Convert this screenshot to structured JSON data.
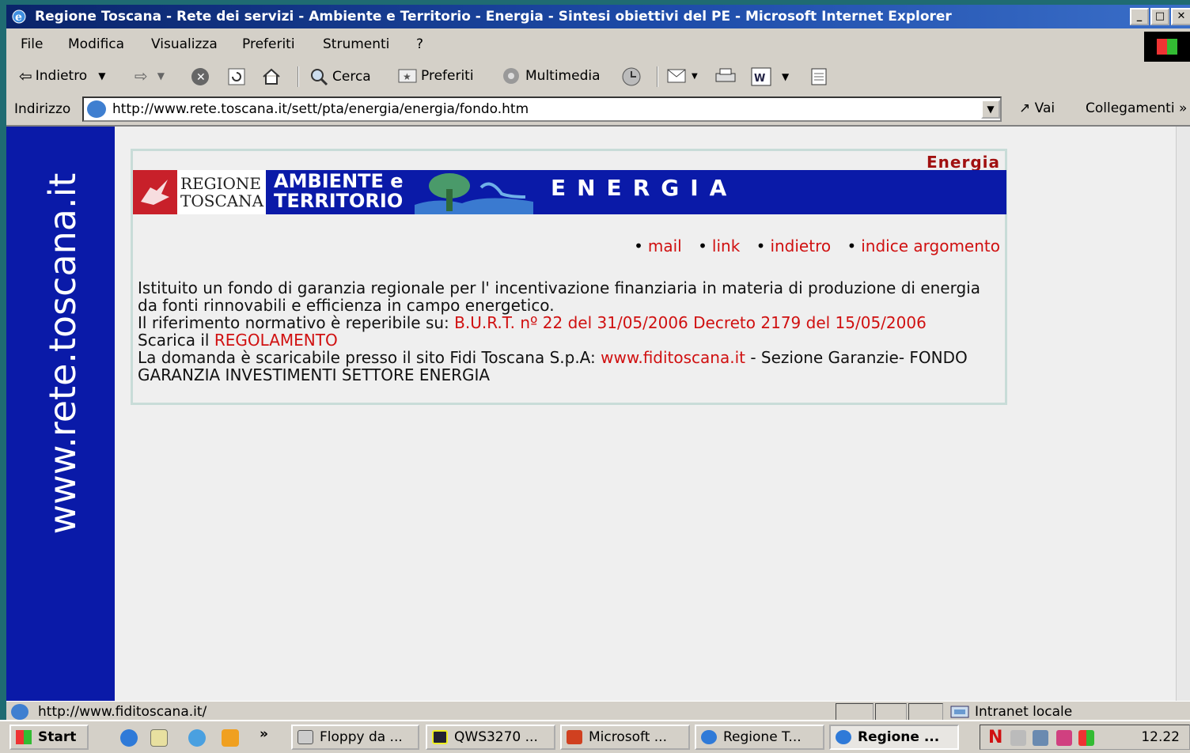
{
  "window": {
    "title": "Regione Toscana - Rete dei servizi - Ambiente e Territorio - Energia - Sintesi obiettivi del PE - Microsoft Internet Explorer",
    "min": "_",
    "max": "□"
  },
  "menu": [
    "File",
    "Modifica",
    "Visualizza",
    "Preferiti",
    "Strumenti",
    "?"
  ],
  "toolbar": {
    "back": "Indietro",
    "search": "Cerca",
    "favorites": "Preferiti",
    "media": "Multimedia"
  },
  "address": {
    "label": "Indirizzo",
    "url": "http://www.rete.toscana.it/sett/pta/energia/energia/fondo.htm",
    "go": "Vai",
    "links": "Collegamenti"
  },
  "page": {
    "sidebar_text": "www.rete.toscana.it",
    "section_title": "Energia",
    "banner": {
      "logo_line1": "REGIONE",
      "logo_line2": "TOSCANA",
      "ambiente_line1": "AMBIENTE e",
      "ambiente_line2": "TERRITORIO",
      "section": "ENERGIA"
    },
    "nav": [
      "mail",
      "link",
      "indietro",
      "indice argomento"
    ],
    "body": {
      "p1": "Istituito un fondo di garanzia regionale per l' incentivazione finanziaria in materia di produzione di energia da fonti rinnovabili e efficienza in campo energetico.",
      "p2_prefix": "Il riferimento normativo è reperibile su: ",
      "p2_link": "B.U.R.T. nº 22 del 31/05/2006 Decreto 2179 del 15/05/2006",
      "p3_prefix": "Scarica il ",
      "p3_link": "REGOLAMENTO",
      "p4_prefix": "La domanda è scaricabile presso il sito Fidi Toscana S.p.A: ",
      "p4_link": "www.fiditoscana.it",
      "p4_suffix": " - Sezione Garanzie- FONDO GARANZIA INVESTIMENTI SETTORE ENERGIA"
    }
  },
  "status": {
    "url": "http://www.fiditoscana.it/",
    "zone": "Intranet locale"
  },
  "taskbar": {
    "start": "Start",
    "tasks": [
      "Floppy da ...",
      "QWS3270 ...",
      "Microsoft ...",
      "Regione T...",
      "Regione ..."
    ],
    "clock": "12.22"
  },
  "colors": {
    "accent_blue": "#0a1aa8",
    "link_red": "#d01010",
    "title_red": "#a01010"
  }
}
